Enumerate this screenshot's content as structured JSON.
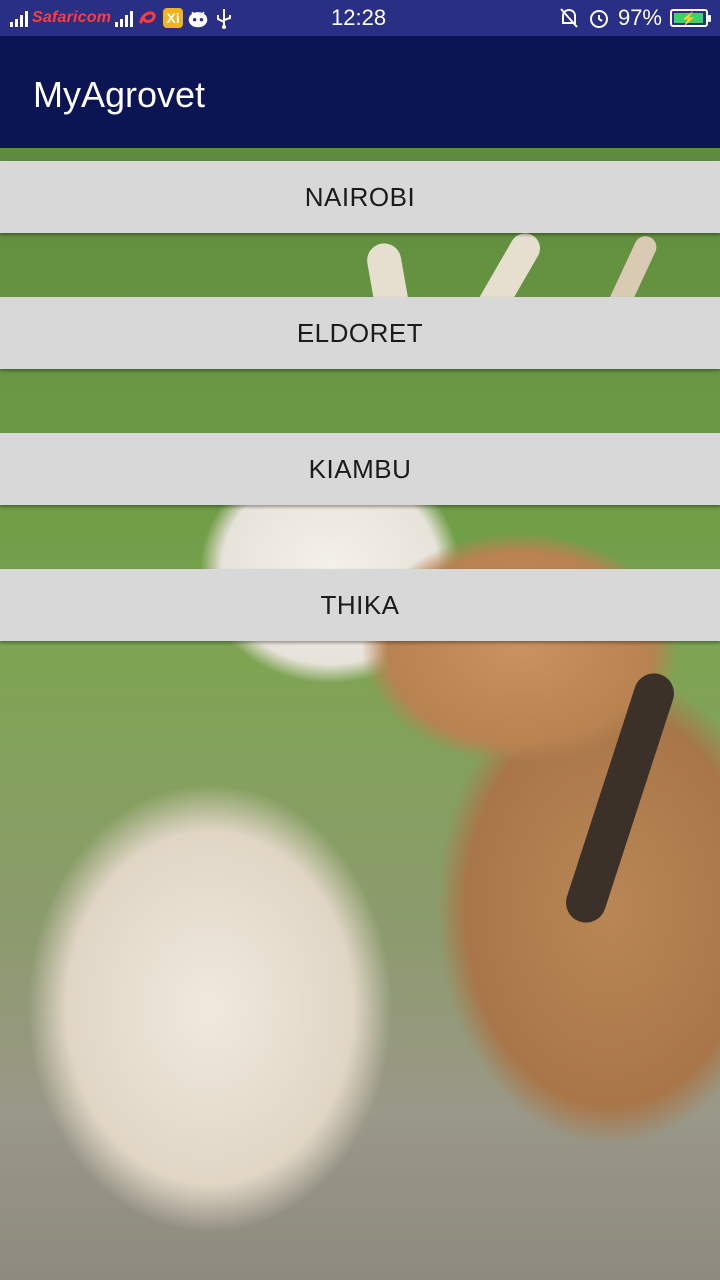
{
  "status_bar": {
    "carrier": "Safaricom",
    "time": "12:28",
    "battery_percent": "97%",
    "icons": [
      "signal-icon",
      "signal-icon",
      "airtel-icon",
      "xiaomi-icon",
      "android-icon",
      "usb-icon",
      "silent-icon",
      "alarm-icon",
      "battery-charging-icon"
    ],
    "battery_level": 0.97
  },
  "app_bar": {
    "title": "MyAgrovet",
    "color": "#0b1553"
  },
  "buttons": [
    {
      "label": "NAIROBI"
    },
    {
      "label": "ELDORET"
    },
    {
      "label": "KIAMBU"
    },
    {
      "label": "THIKA"
    }
  ],
  "background_image": {
    "subject": "sheep-and-goat-photo"
  }
}
